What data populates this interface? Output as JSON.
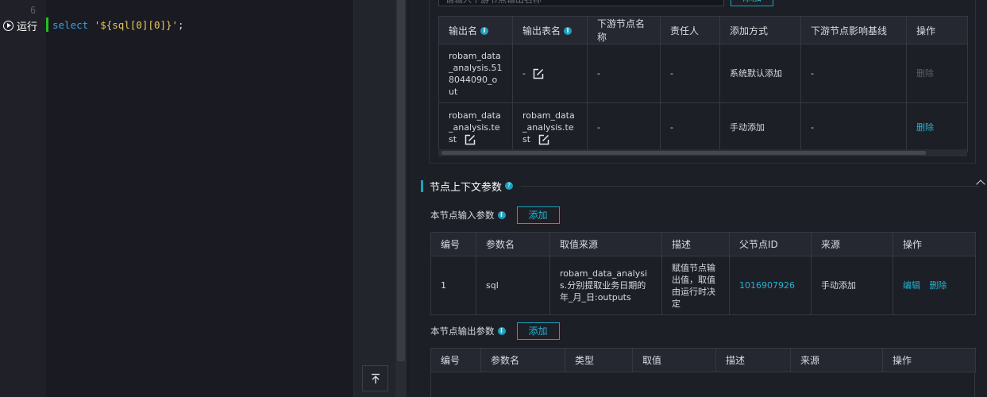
{
  "editor": {
    "line_number": "6",
    "run_label": "运行",
    "code": {
      "keyword": "select",
      "string": "'${sql[0][0]}'",
      "terminator": ";"
    }
  },
  "output_top": {
    "search_placeholder": "请输入下游节点输出名称",
    "add_label": "添加"
  },
  "output_table": {
    "headers": [
      "输出名",
      "输出表名",
      "下游节点名称",
      "责任人",
      "添加方式",
      "下游节点影响基线",
      "操作"
    ],
    "rows": [
      {
        "name": "robam_data_analysis.518044090_out",
        "table": "-",
        "downstream": "-",
        "owner": "-",
        "method": "系统默认添加",
        "baseline": "-",
        "action": "删除"
      },
      {
        "name": "robam_data_analysis.test",
        "table": "robam_data_analysis.test",
        "downstream": "-",
        "owner": "-",
        "method": "手动添加",
        "baseline": "-",
        "action": "删除"
      }
    ]
  },
  "context_section": {
    "title": "节点上下文参数"
  },
  "input_params": {
    "title": "本节点输入参数",
    "add_label": "添加",
    "headers": [
      "编号",
      "参数名",
      "取值来源",
      "描述",
      "父节点ID",
      "来源",
      "操作"
    ],
    "rows": [
      {
        "id": "1",
        "name": "sql",
        "source": "robam_data_analysis.分别提取业务日期的年_月_日:outputs",
        "desc": "赋值节点输出值，取值由运行时决定",
        "parent_id": "1016907926",
        "origin": "手动添加",
        "edit": "编辑",
        "delete": "删除"
      }
    ]
  },
  "output_params": {
    "title": "本节点输出参数",
    "add_label": "添加",
    "headers": [
      "编号",
      "参数名",
      "类型",
      "取值",
      "描述",
      "来源",
      "操作"
    ]
  },
  "colors": {
    "accent": "#1fa1bd",
    "link": "#22b3d1",
    "cursor_marker": "#1fc21f",
    "code_keyword": "#3b9fe6",
    "code_string": "#e6c75e"
  }
}
